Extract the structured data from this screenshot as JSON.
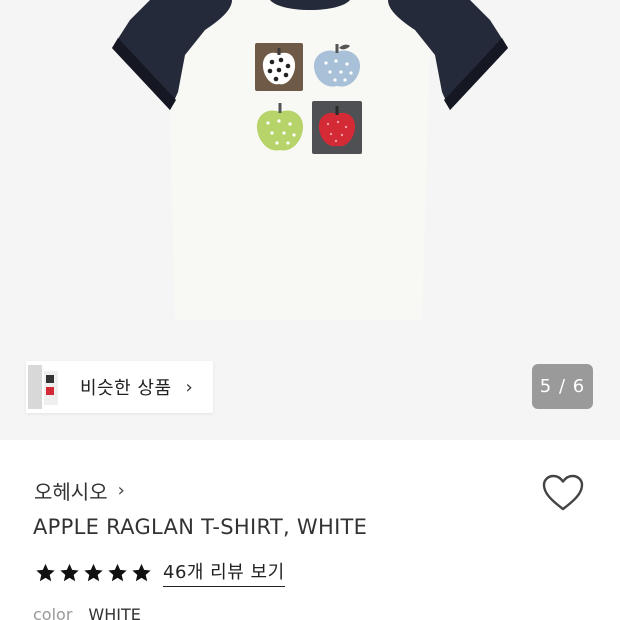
{
  "gallery": {
    "image_alt_icon": "raglan-tshirt-photo",
    "similar_label": "비슷한 상품",
    "pager_text": "5 / 6"
  },
  "product": {
    "brand": "오헤시오",
    "title": "APPLE RAGLAN T-SHIRT, WHITE",
    "rating_stars": 5,
    "review_link": "46개 리뷰 보기",
    "option_key": "color",
    "option_value": "WHITE"
  },
  "colors": {
    "sleeve": "#252a3a",
    "shirt_body": "#f8f8f4",
    "tile_brown": "#6e5a46",
    "tile_blue": "#a9c1d8",
    "tile_green": "#b6d46a",
    "tile_dark": "#4f5053",
    "apple_red": "#d42a36",
    "pager_bg": "#9a9a9a"
  }
}
